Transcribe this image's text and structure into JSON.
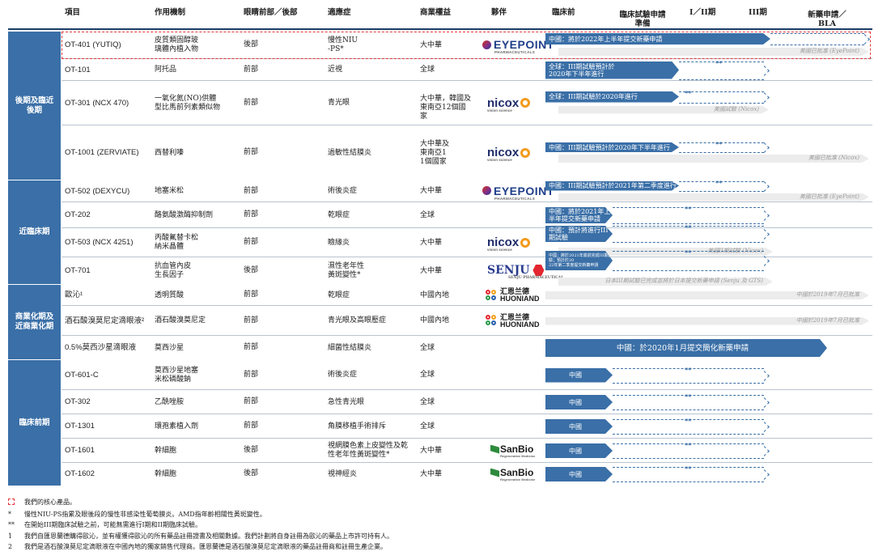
{
  "headers": {
    "project": "項目",
    "mechanism": "作用機制",
    "eye": "眼睛前部／後部",
    "indication": "適應症",
    "rights": "商業權益",
    "partner": "夥伴",
    "preclinical": "臨床前",
    "ind_prep": "臨床試驗申請準備",
    "phase12": "I／II期",
    "phase3": "III期",
    "nda": "新藥申請／BLA"
  },
  "groups": {
    "late": "後期及臨近後期",
    "near": "近臨床期",
    "commercial": "商業化期及近商業化期",
    "preclinical": "臨床前期"
  },
  "rows": [
    {
      "product": "OT-401 (YUTIQ)",
      "mechanism": "皮質類固醇玻璃體內植入物",
      "eye": "後部",
      "indication": "慢性NIU-PS*",
      "rights": "大中華",
      "partner": "EyePoint",
      "bar": "中國：將於2022年上半年提交新藥申請",
      "gray": "美國已批准 (EyePoint)"
    },
    {
      "product": "OT-101",
      "mechanism": "阿托品",
      "eye": "前部",
      "indication": "近視",
      "rights": "全球",
      "partner": "",
      "bar": "全球：III期試驗預計於2020年下半年進行",
      "gray": ""
    },
    {
      "product": "OT-301 (NCX 470)",
      "mechanism": "一氧化氮(NO)供體型比馬前列素類似物",
      "eye": "前部",
      "indication": "青光眼",
      "rights": "大中華，韓國及東南亞12個國家",
      "partner": "nicox",
      "bar": "全球：III期試驗於2020年進行",
      "gray": "美國試驗 (Nicox)"
    },
    {
      "product": "OT-1001 (ZERVIATE)",
      "mechanism": "西替利嗪",
      "eye": "前部",
      "indication": "過敏性結膜炎",
      "rights": "大中華及東南亞11個國家",
      "partner": "nicox",
      "bar": "中國：III期試驗預計於2020年下半年進行",
      "gray": "美國已批准 (Nicox)"
    },
    {
      "product": "OT-502 (DEXYCU)",
      "mechanism": "地塞米松",
      "eye": "前部",
      "indication": "術後炎症",
      "rights": "大中華",
      "partner": "EyePoint",
      "bar": "中國：III期試驗預計於2021年第二季度進行",
      "gray": "美國已批准 (EyePoint)"
    },
    {
      "product": "OT-202",
      "mechanism": "酪氨酸激酶抑制劑",
      "eye": "前部",
      "indication": "乾眼症",
      "rights": "全球",
      "partner": "",
      "bar": "中國：將於2021年上半年提交新藥申請",
      "gray": ""
    },
    {
      "product": "OT-503 (NCX 4251)",
      "mechanism": "丙酸氟替卡松納米晶體",
      "eye": "前部",
      "indication": "瞼緣炎",
      "rights": "大中華",
      "partner": "nicox",
      "bar": "中國：預計將進行III期試驗",
      "gray": "美國II期試驗 (Nicox)"
    },
    {
      "product": "OT-701",
      "mechanism": "抗血管內皮生長因子",
      "eye": "後部",
      "indication": "濕性老年性黃斑變性*",
      "rights": "大中華",
      "partner": "SENJU",
      "bar": "中國：將於2021年底前完成III期試驗；預計於2022年第二季度提交新藥申請",
      "gray": "日本III期試驗已完成並將於日本提交新藥申請 (Senju 及 GTS)"
    },
    {
      "product": "歐沁¹",
      "mechanism": "透明質酸",
      "eye": "前部",
      "indication": "乾眼症",
      "rights": "中國內地",
      "partner": "HUONIAN",
      "bar": "",
      "gray": "中國於2019年7月已批准"
    },
    {
      "product": "酒石酸溴莫尼定滴眼液²",
      "mechanism": "酒石酸溴莫尼定",
      "eye": "前部",
      "indication": "青光眼及高眼壓症",
      "rights": "中國內地",
      "partner": "HUONIAN",
      "bar": "",
      "gray": "中國於2019年7月已批准"
    },
    {
      "product": "0.5%莫西沙星滴眼液",
      "mechanism": "莫西沙星",
      "eye": "前部",
      "indication": "細菌性結膜炎",
      "rights": "全球",
      "partner": "",
      "bar": "中國：於2020年1月提交簡化新藥申請",
      "gray": ""
    },
    {
      "product": "OT-601-C",
      "mechanism": "莫西沙星地塞米松磷酸鈉",
      "eye": "前部",
      "indication": "術後炎症",
      "rights": "全球",
      "partner": "",
      "bar": "中國",
      "gray": ""
    },
    {
      "product": "OT-302",
      "mechanism": "乙酰唑胺",
      "eye": "前部",
      "indication": "急性青光眼",
      "rights": "全球",
      "partner": "",
      "bar": "中國",
      "gray": ""
    },
    {
      "product": "OT-1301",
      "mechanism": "環孢素植入劑",
      "eye": "前部",
      "indication": "角膜移植手術排斥",
      "rights": "全球",
      "partner": "",
      "bar": "中國",
      "gray": ""
    },
    {
      "product": "OT-1601",
      "mechanism": "幹細胞",
      "eye": "後部",
      "indication": "視網膜色素上皮變性及乾性老年性黃斑變性*",
      "rights": "大中華",
      "partner": "SanBio",
      "bar": "中國",
      "gray": ""
    },
    {
      "product": "OT-1602",
      "mechanism": "幹細胞",
      "eye": "後部",
      "indication": "視神經炎",
      "rights": "大中華",
      "partner": "SanBio",
      "bar": "中國",
      "gray": ""
    }
  ],
  "partners": {
    "eyepoint": "EYEPOINT",
    "eyepoint_sub": "PHARMACEUTICALS",
    "nicox": "nicox",
    "nicox_sub": "vision science",
    "senju": "SENJU",
    "senju_sub": "SENJU PHARMACEUTICAL",
    "huonian_cn": "汇恩兰德",
    "huonian_en": "HUONIAND",
    "sanbio": "SanBio",
    "sanbio_sub": "Regenerative Medicine"
  },
  "star": "**",
  "footnotes": {
    "core": "我們的核心產品。",
    "f1k": "*",
    "f1": "慢性NIU-PS指累及眼後段的慢性非感染性葡萄膜炎。AMD指年齡相關性黃斑變性。",
    "f2k": "**",
    "f2": "在開始III期臨床試驗之前，可能無需進行I期和II期臨床試驗。",
    "f3k": "1",
    "f3": "我們自匯恩蘭德購得歐沁，並有權獲得歐沁的所有藥品註冊證書及相關數據。我們計劃將自身註冊為歐沁的藥品上市許可持有人。",
    "f4k": "2",
    "f4": "我們是酒石酸溴莫尼定滴眼液在中國內地的獨家銷售代理商。匯恩蘭德是酒石酸溴莫尼定滴眼液的藥品註冊商和註冊生產企業。"
  },
  "colors": {
    "bar": "#3a6fa7",
    "group": "#3a6fa7",
    "gray": "#ececec",
    "core": "#e0373a"
  }
}
